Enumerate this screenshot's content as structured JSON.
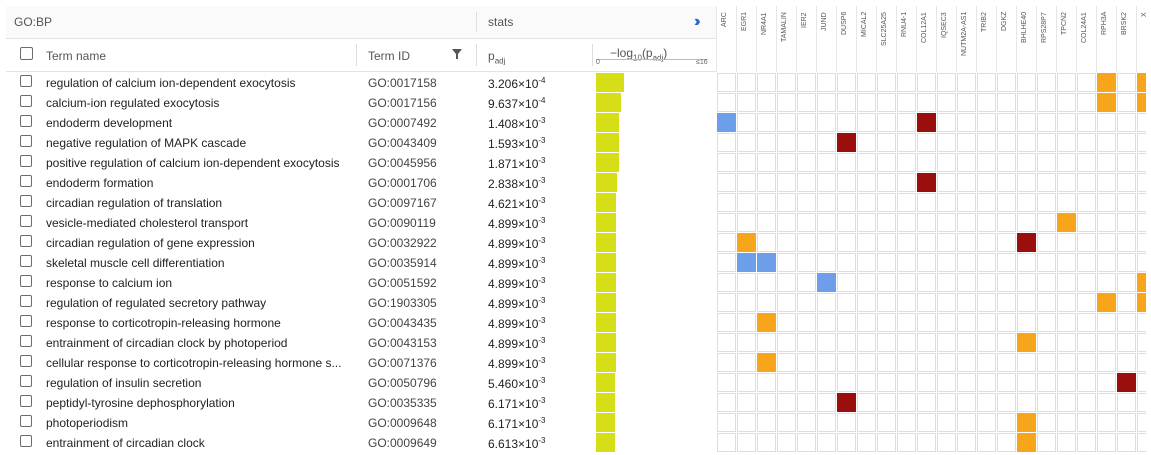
{
  "header": {
    "title": "GO:BP",
    "stats_label": "stats",
    "expand_icon": "double-chevron-right-icon"
  },
  "columns": {
    "term_name": "Term name",
    "term_id": "Term ID",
    "padj": "p",
    "padj_sub": "adj",
    "log_label": "−log",
    "log_sub": "10",
    "log_p": "(p",
    "log_p_sub": "adj",
    "log_close": ")",
    "scale_min": "0",
    "scale_max": "≤16"
  },
  "genes": [
    "ARC",
    "EGR1",
    "NR4A1",
    "TAMALIN",
    "IER2",
    "JUND",
    "DUSP6",
    "MICAL2",
    "SLC25A25",
    "RNU4-1",
    "COL12A1",
    "IQSEC3",
    "NUTM2A-AS1",
    "TRIB2",
    "DGKZ",
    "BHLHE40",
    "RPS28P7",
    "TPCN2",
    "COL24A1",
    "RPH3A",
    "BRSK2",
    "X"
  ],
  "colors": {
    "orange": "#f7a51b",
    "blue": "#6d9eea",
    "darkred": "#9b0e0e",
    "bar": "#d6de18"
  },
  "terms": [
    {
      "name": "regulation of calcium ion-dependent exocytosis",
      "id": "GO:0017158",
      "p": "3.206×10",
      "e": "-4",
      "bar": 3.49,
      "cells": [
        [
          19,
          "orange"
        ],
        [
          21,
          "orange"
        ]
      ]
    },
    {
      "name": "calcium-ion regulated exocytosis",
      "id": "GO:0017156",
      "p": "9.637×10",
      "e": "-4",
      "bar": 3.02,
      "cells": [
        [
          19,
          "orange"
        ],
        [
          21,
          "orange"
        ]
      ]
    },
    {
      "name": "endoderm development",
      "id": "GO:0007492",
      "p": "1.408×10",
      "e": "-3",
      "bar": 2.85,
      "cells": [
        [
          0,
          "blue"
        ],
        [
          10,
          "darkred"
        ]
      ]
    },
    {
      "name": "negative regulation of MAPK cascade",
      "id": "GO:0043409",
      "p": "1.593×10",
      "e": "-3",
      "bar": 2.8,
      "cells": [
        [
          6,
          "darkred"
        ]
      ]
    },
    {
      "name": "positive regulation of calcium ion-dependent exocytosis",
      "id": "GO:0045956",
      "p": "1.871×10",
      "e": "-3",
      "bar": 2.73,
      "cells": []
    },
    {
      "name": "endoderm formation",
      "id": "GO:0001706",
      "p": "2.838×10",
      "e": "-3",
      "bar": 2.55,
      "cells": [
        [
          10,
          "darkred"
        ]
      ]
    },
    {
      "name": "circadian regulation of translation",
      "id": "GO:0097167",
      "p": "4.621×10",
      "e": "-3",
      "bar": 2.34,
      "cells": []
    },
    {
      "name": "vesicle-mediated cholesterol transport",
      "id": "GO:0090119",
      "p": "4.899×10",
      "e": "-3",
      "bar": 2.31,
      "cells": [
        [
          17,
          "orange"
        ]
      ]
    },
    {
      "name": "circadian regulation of gene expression",
      "id": "GO:0032922",
      "p": "4.899×10",
      "e": "-3",
      "bar": 2.31,
      "cells": [
        [
          1,
          "orange"
        ],
        [
          15,
          "darkred"
        ]
      ]
    },
    {
      "name": "skeletal muscle cell differentiation",
      "id": "GO:0035914",
      "p": "4.899×10",
      "e": "-3",
      "bar": 2.31,
      "cells": [
        [
          1,
          "blue"
        ],
        [
          2,
          "blue"
        ]
      ]
    },
    {
      "name": "response to calcium ion",
      "id": "GO:0051592",
      "p": "4.899×10",
      "e": "-3",
      "bar": 2.31,
      "cells": [
        [
          5,
          "blue"
        ],
        [
          21,
          "orange"
        ]
      ]
    },
    {
      "name": "regulation of regulated secretory pathway",
      "id": "GO:1903305",
      "p": "4.899×10",
      "e": "-3",
      "bar": 2.31,
      "cells": [
        [
          19,
          "orange"
        ],
        [
          21,
          "orange"
        ]
      ]
    },
    {
      "name": "response to corticotropin-releasing hormone",
      "id": "GO:0043435",
      "p": "4.899×10",
      "e": "-3",
      "bar": 2.31,
      "cells": [
        [
          2,
          "orange"
        ]
      ]
    },
    {
      "name": "entrainment of circadian clock by photoperiod",
      "id": "GO:0043153",
      "p": "4.899×10",
      "e": "-3",
      "bar": 2.31,
      "cells": [
        [
          15,
          "orange"
        ]
      ]
    },
    {
      "name": "cellular response to corticotropin-releasing hormone s...",
      "id": "GO:0071376",
      "p": "4.899×10",
      "e": "-3",
      "bar": 2.31,
      "cells": [
        [
          2,
          "orange"
        ]
      ]
    },
    {
      "name": "regulation of insulin secretion",
      "id": "GO:0050796",
      "p": "5.460×10",
      "e": "-3",
      "bar": 2.26,
      "cells": [
        [
          20,
          "darkred"
        ]
      ]
    },
    {
      "name": "peptidyl-tyrosine dephosphorylation",
      "id": "GO:0035335",
      "p": "6.171×10",
      "e": "-3",
      "bar": 2.21,
      "cells": [
        [
          6,
          "darkred"
        ]
      ]
    },
    {
      "name": "photoperiodism",
      "id": "GO:0009648",
      "p": "6.171×10",
      "e": "-3",
      "bar": 2.21,
      "cells": [
        [
          15,
          "orange"
        ]
      ]
    },
    {
      "name": "entrainment of circadian clock",
      "id": "GO:0009649",
      "p": "6.613×10",
      "e": "-3",
      "bar": 2.18,
      "cells": [
        [
          15,
          "orange"
        ]
      ]
    }
  ]
}
